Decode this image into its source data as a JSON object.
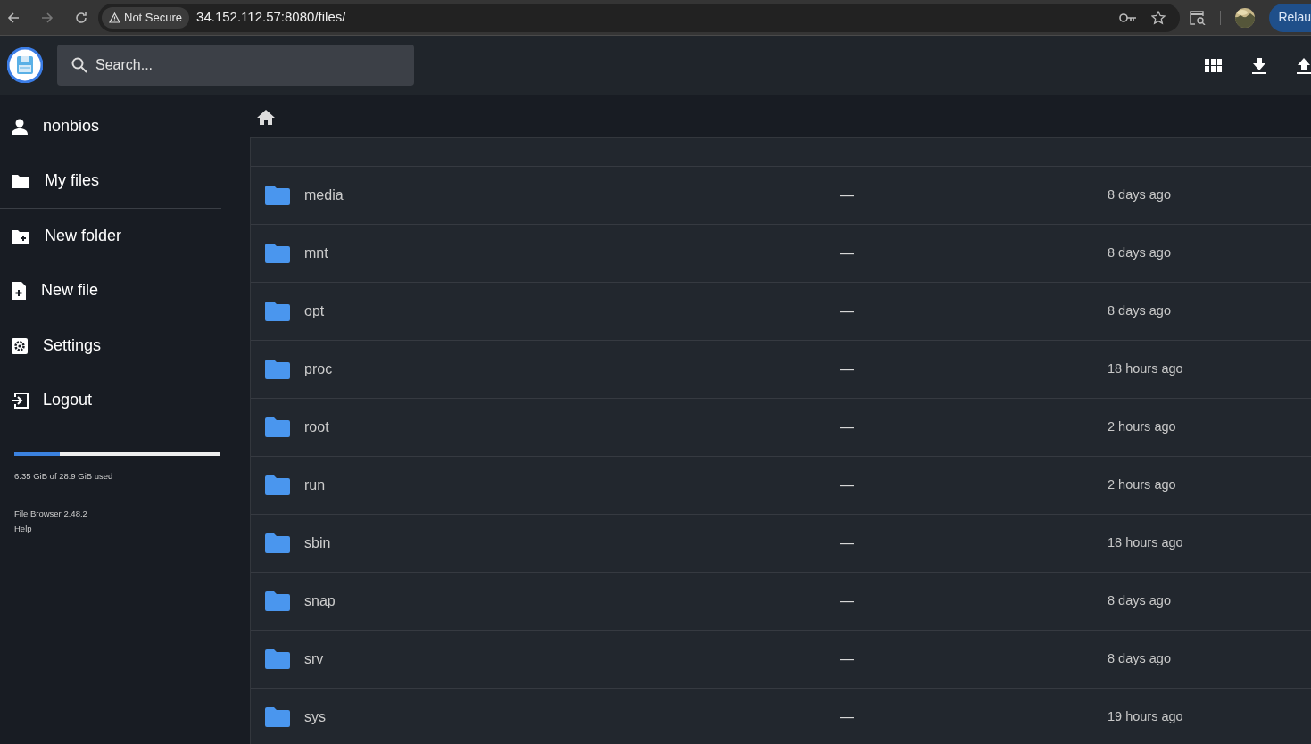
{
  "browser": {
    "security_label": "Not Secure",
    "url": "34.152.112.57:8080/files/",
    "relaunch_label": "Relau"
  },
  "header": {
    "search": {
      "placeholder": "Search..."
    }
  },
  "sidebar": {
    "user": "nonbios",
    "groups": [
      [
        {
          "label": "My files"
        }
      ],
      [
        {
          "label": "New folder"
        },
        {
          "label": "New file"
        }
      ],
      [
        {
          "label": "Settings"
        },
        {
          "label": "Logout"
        }
      ]
    ],
    "usage": {
      "level": 0.22,
      "text": "6.35 GiB of 28.9 GiB used"
    },
    "version": "File Browser 2.48.2",
    "help": "Help"
  },
  "rows": [
    {
      "name": "media",
      "size": "—",
      "modified": "8 days ago"
    },
    {
      "name": "mnt",
      "size": "—",
      "modified": "8 days ago"
    },
    {
      "name": "opt",
      "size": "—",
      "modified": "8 days ago"
    },
    {
      "name": "proc",
      "size": "—",
      "modified": "18 hours ago"
    },
    {
      "name": "root",
      "size": "—",
      "modified": "2 hours ago"
    },
    {
      "name": "run",
      "size": "—",
      "modified": "2 hours ago"
    },
    {
      "name": "sbin",
      "size": "—",
      "modified": "18 hours ago"
    },
    {
      "name": "snap",
      "size": "—",
      "modified": "8 days ago"
    },
    {
      "name": "srv",
      "size": "—",
      "modified": "8 days ago"
    },
    {
      "name": "sys",
      "size": "—",
      "modified": "19 hours ago"
    }
  ]
}
